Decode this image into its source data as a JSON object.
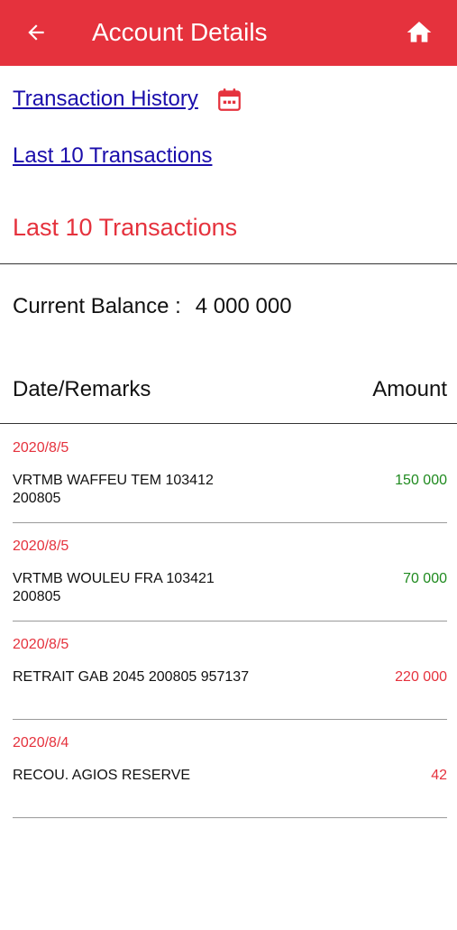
{
  "header": {
    "title": "Account Details",
    "back_icon": "arrow-left-icon",
    "home_icon": "home-icon",
    "background_color": "#e5323d"
  },
  "links": {
    "transaction_history": "Transaction History",
    "calendar_icon": "calendar-icon",
    "last_10": "Last 10 Transactions"
  },
  "section_title": "Last 10 Transactions",
  "balance": {
    "label": "Current Balance :",
    "value": "4 000 000"
  },
  "table": {
    "col_left": "Date/Remarks",
    "col_right": "Amount",
    "rows": [
      {
        "date": "2020/8/5",
        "remarks": "VRTMB WAFFEU TEM 103412 200805",
        "amount": "150 000",
        "type": "credit"
      },
      {
        "date": "2020/8/5",
        "remarks": "VRTMB WOULEU FRA 103421 200805",
        "amount": "70 000",
        "type": "credit"
      },
      {
        "date": "2020/8/5",
        "remarks": "RETRAIT GAB 2045 200805 957137",
        "amount": "220 000",
        "type": "debit"
      },
      {
        "date": "2020/8/4",
        "remarks": "RECOU. AGIOS RESERVE",
        "amount": "42",
        "type": "debit"
      }
    ]
  },
  "colors": {
    "accent": "#e5323d",
    "link": "#1a0dab",
    "credit": "#1f8a1f",
    "debit": "#e5323d"
  }
}
